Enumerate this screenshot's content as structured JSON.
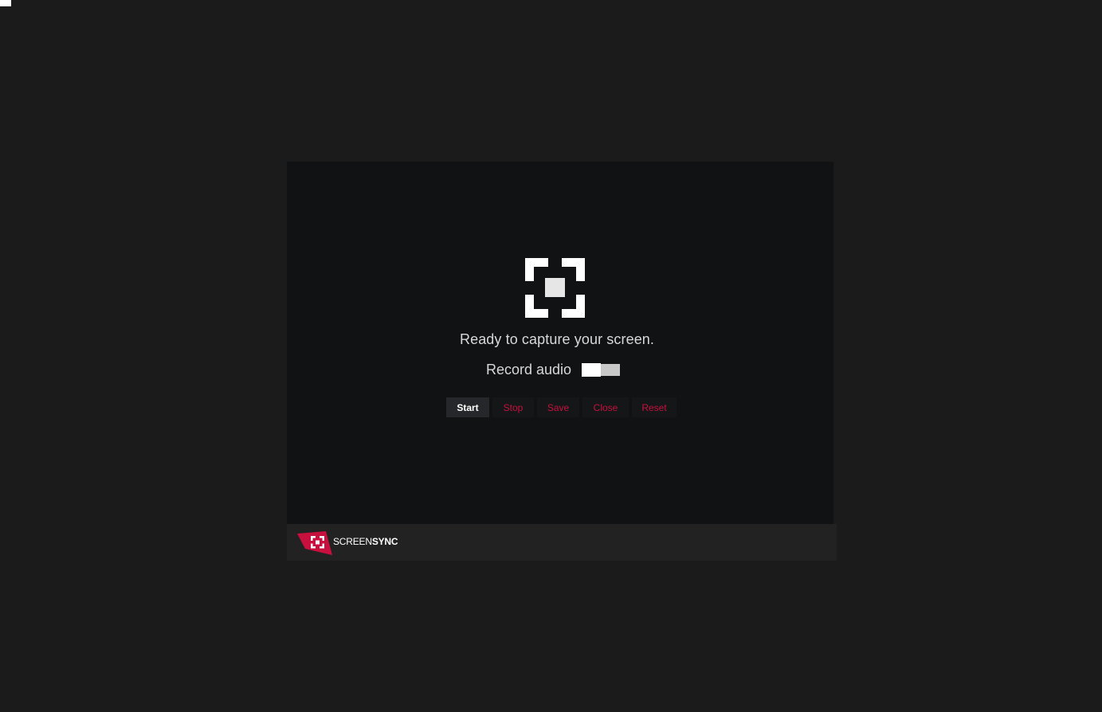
{
  "status": {
    "message": "Ready to capture your screen."
  },
  "audio": {
    "label": "Record audio",
    "enabled": false
  },
  "buttons": {
    "start": "Start",
    "stop": "Stop",
    "save": "Save",
    "close": "Close",
    "reset": "Reset"
  },
  "brand": {
    "name_light": "SCREEN",
    "name_bold": "SYNC",
    "logo_icon": "screen-capture-icon",
    "accent_color": "#c8103f"
  },
  "icons": {
    "main": "screen-capture-icon"
  }
}
